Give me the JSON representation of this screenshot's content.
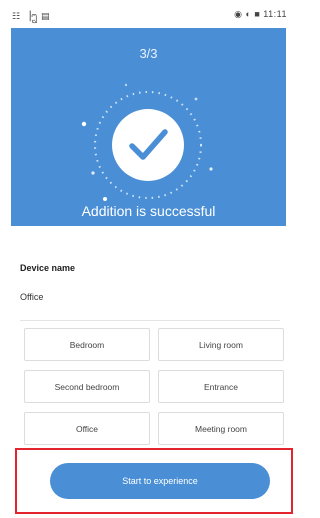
{
  "status_bar": {
    "left_text": "☷ ▕ᩂ ▤",
    "right_text": "◉ ◐ ■ 11:11"
  },
  "hero": {
    "step": "3/3",
    "title": "Addition is successful",
    "check_icon": "check-circle-icon",
    "background_color": "#4a8fd6"
  },
  "device": {
    "label": "Device name",
    "value": "Office"
  },
  "rooms": [
    {
      "label": "Bedroom"
    },
    {
      "label": "Living room"
    },
    {
      "label": "Second bedroom"
    },
    {
      "label": "Entrance"
    },
    {
      "label": "Office"
    },
    {
      "label": "Meeting room"
    }
  ],
  "actions": {
    "start_label": "Start to experience",
    "highlight_color": "#e2242e"
  }
}
